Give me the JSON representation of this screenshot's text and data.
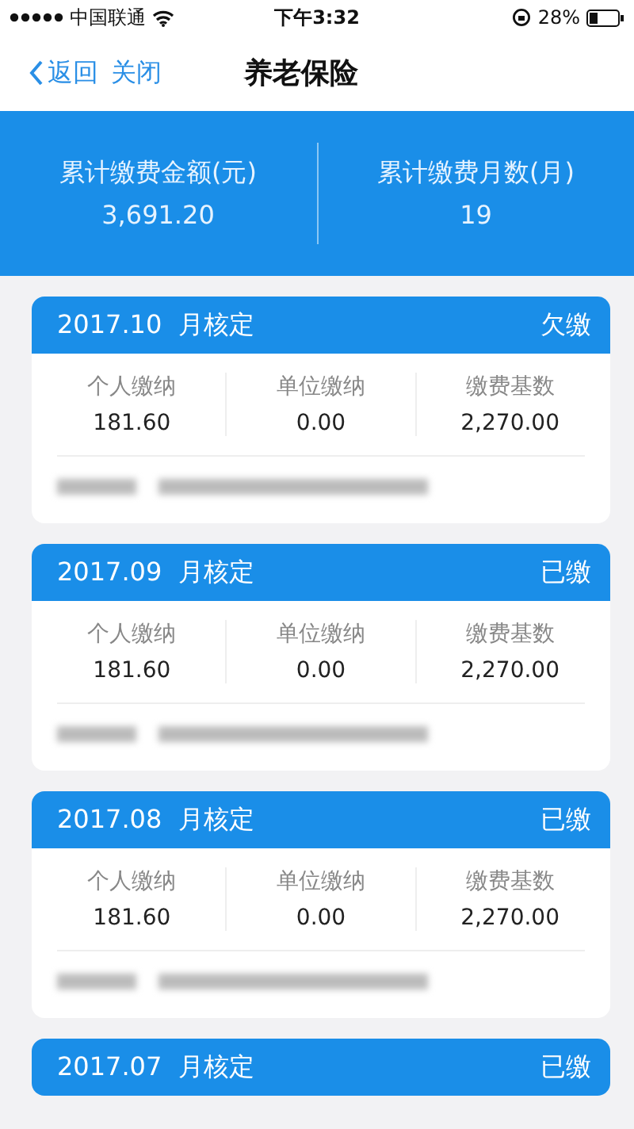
{
  "status_bar": {
    "carrier": "中国联通",
    "time": "下午3:32",
    "battery": "28%"
  },
  "nav": {
    "back": "返回",
    "close": "关闭",
    "title": "养老保险"
  },
  "summary": [
    {
      "label": "累计缴费金额(元)",
      "value": "3,691.20"
    },
    {
      "label": "累计缴费月数(月)",
      "value": "19"
    }
  ],
  "records": [
    {
      "month": "2017.10",
      "suffix": "月核定",
      "status": "欠缴",
      "cells": [
        {
          "label": "个人缴纳",
          "value": "181.60"
        },
        {
          "label": "单位缴纳",
          "value": "0.00"
        },
        {
          "label": "缴费基数",
          "value": "2,270.00"
        }
      ]
    },
    {
      "month": "2017.09",
      "suffix": "月核定",
      "status": "已缴",
      "cells": [
        {
          "label": "个人缴纳",
          "value": "181.60"
        },
        {
          "label": "单位缴纳",
          "value": "0.00"
        },
        {
          "label": "缴费基数",
          "value": "2,270.00"
        }
      ]
    },
    {
      "month": "2017.08",
      "suffix": "月核定",
      "status": "已缴",
      "cells": [
        {
          "label": "个人缴纳",
          "value": "181.60"
        },
        {
          "label": "单位缴纳",
          "value": "0.00"
        },
        {
          "label": "缴费基数",
          "value": "2,270.00"
        }
      ]
    },
    {
      "month": "2017.07",
      "suffix": "月核定",
      "status": "已缴"
    }
  ]
}
